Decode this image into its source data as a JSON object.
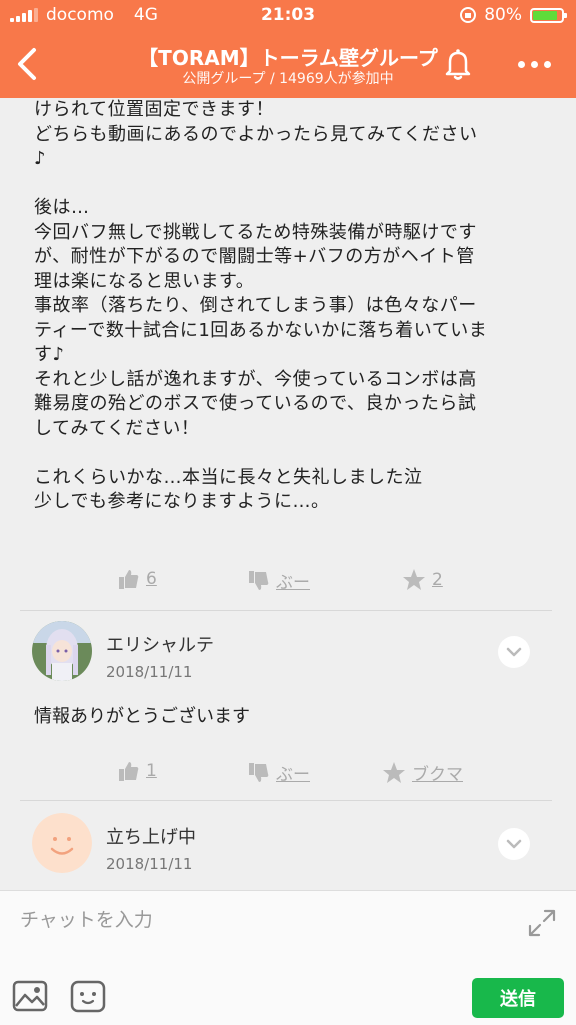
{
  "status_bar": {
    "carrier": "docomo",
    "network": "4G",
    "time": "21:03",
    "battery": "80%",
    "battery_level": 0.8
  },
  "header": {
    "title": "【TORAM】トーラム壁グループ",
    "subtitle": "公開グループ / 14969人が参加中"
  },
  "post": {
    "text": "けられて位置固定できます！\nどちらも動画にあるのでよかったら見てみてください\n♪\n\n後は…\n今回バフ無しで挑戦してるため特殊装備が時駆けです\nが、耐性が下がるので闇闘士等+バフの方がヘイト管\n理は楽になると思います。\n事故率（落ちたり、倒されてしまう事）は色々なパー\nティーで数十試合に1回あるかないかに落ち着いていま\nす♪\nそれと少し話が逸れますが、今使っているコンボは高\n難易度の殆どのボスで使っているので、良かったら試\nしてみてください！\n\nこれくらいかな…本当に長々と失礼しました泣\n少しでも参考になりますように…。",
    "like_count": "6",
    "dislike_label": "ぶー",
    "bookmark_count": "2"
  },
  "comments": [
    {
      "name": "エリシャルテ",
      "date": "2018/11/11",
      "text": "情報ありがとうございます",
      "like_count": "1",
      "dislike_label": "ぶー",
      "bookmark_label": "ブクマ"
    },
    {
      "name": "立ち上げ中",
      "date": "2018/11/11"
    }
  ],
  "input": {
    "placeholder": "チャットを入力",
    "send_label": "送信"
  },
  "colors": {
    "header": "#f8784a",
    "send": "#18b84b",
    "battery_fill": "#5fdc3a"
  }
}
